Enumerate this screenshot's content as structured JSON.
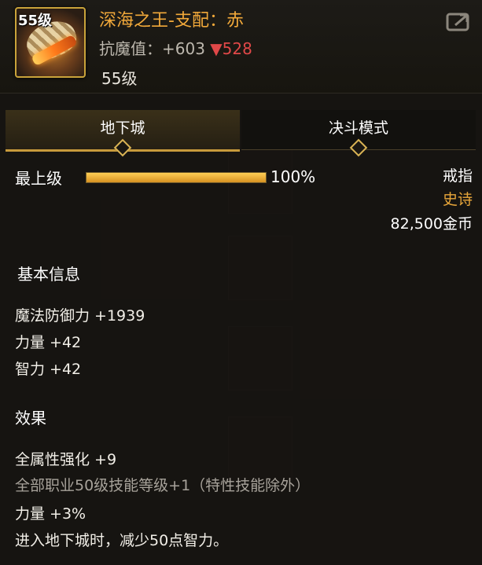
{
  "item": {
    "level_badge": "55级",
    "name": "深海之王-支配：赤",
    "resist_label": "抗魔值：",
    "resist_value": "+603",
    "resist_delta": "▼528",
    "required_level": "55级"
  },
  "tabs": [
    {
      "label": "地下城",
      "active": true
    },
    {
      "label": "决斗模式",
      "active": false
    }
  ],
  "grade": {
    "label": "最上级",
    "percent_text": "100%",
    "percent": 100
  },
  "meta": {
    "type": "戒指",
    "rarity": "史诗",
    "price": "82,500金币"
  },
  "basic_info": {
    "title": "基本信息",
    "lines": [
      "魔法防御力 +1939",
      "力量 +42",
      "智力 +42"
    ]
  },
  "effects": {
    "title": "效果",
    "lines": [
      "全属性强化 +9",
      "全部职业50级技能等级+1（特性技能除外）",
      "力量 +3%",
      "进入地下城时，减少50点智力。"
    ]
  },
  "colors": {
    "rarity": "#e8a63a",
    "name": "#f2a93a",
    "delta": "#e04848",
    "accent": "#c79a3c"
  },
  "icons": {
    "share": "share-icon",
    "item": "ring-item-icon"
  }
}
